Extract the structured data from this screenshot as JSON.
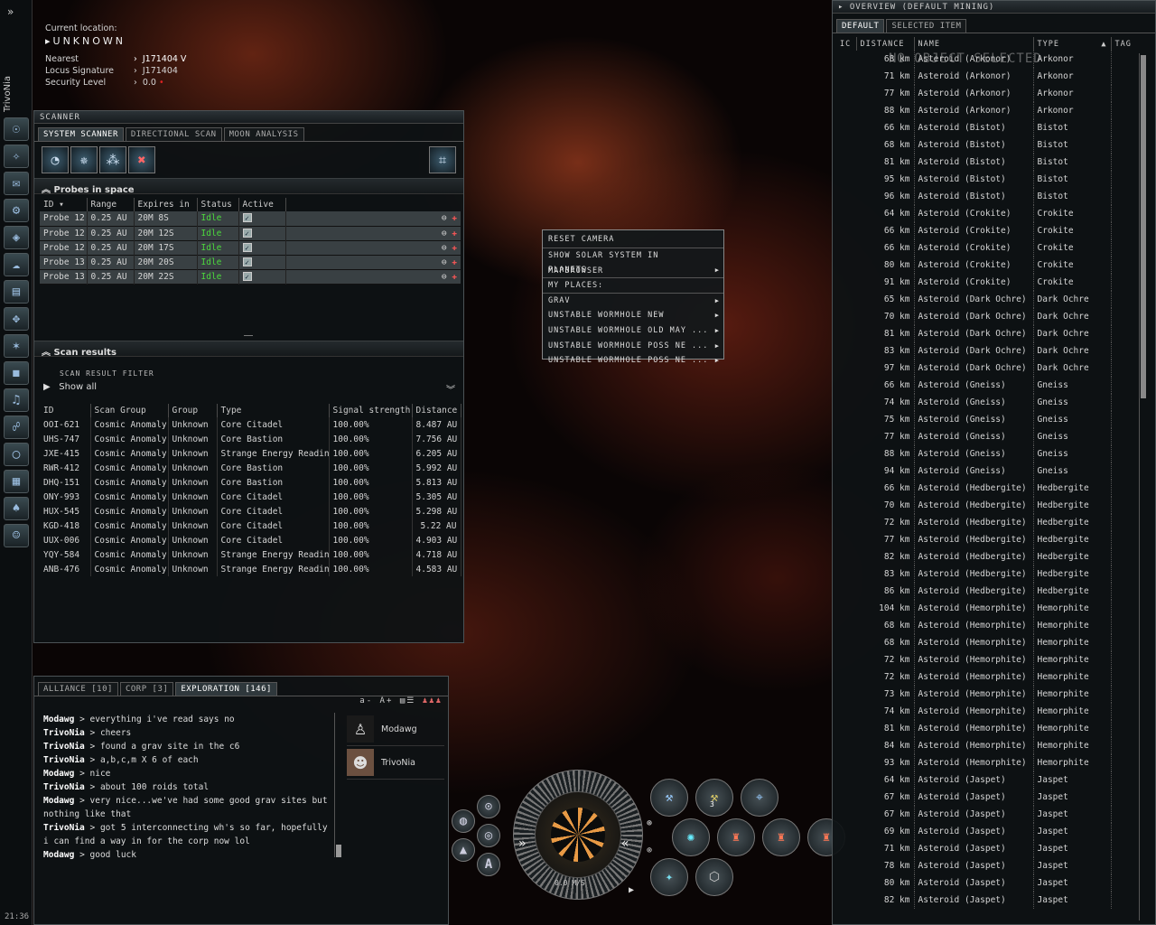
{
  "sidebar": {
    "player": "TrivoNia",
    "clock": "21:36"
  },
  "location": {
    "label": "Current location:",
    "name": "UNKNOWN",
    "nearest_label": "Nearest",
    "nearest": "J171404 V",
    "locus_label": "Locus Signature",
    "locus": "J171404",
    "security_label": "Security Level",
    "security": "0.0"
  },
  "scanner": {
    "title": "SCANNER",
    "tabs": [
      "SYSTEM SCANNER",
      "DIRECTIONAL SCAN",
      "MOON ANALYSIS"
    ],
    "probes_title": "Probes in space",
    "probe_columns": [
      "ID",
      "Range",
      "Expires in",
      "Status",
      "Active"
    ],
    "probes": [
      [
        "Probe 12",
        "0.25 AU",
        "20M 8S",
        "Idle"
      ],
      [
        "Probe 12",
        "0.25 AU",
        "20M 12S",
        "Idle"
      ],
      [
        "Probe 12",
        "0.25 AU",
        "20M 17S",
        "Idle"
      ],
      [
        "Probe 13",
        "0.25 AU",
        "20M 20S",
        "Idle"
      ],
      [
        "Probe 13",
        "0.25 AU",
        "20M 22S",
        "Idle"
      ]
    ],
    "results_title": "Scan results",
    "filter_label": "SCAN RESULT FILTER",
    "filter_value": "Show all",
    "result_columns": [
      "ID",
      "Scan Group",
      "Group",
      "Type",
      "Signal strength",
      "Distance"
    ],
    "results": [
      [
        "OOI-621",
        "Cosmic Anomaly",
        "Unknown",
        "Core Citadel",
        "100.00%",
        "8.487 AU"
      ],
      [
        "UHS-747",
        "Cosmic Anomaly",
        "Unknown",
        "Core Bastion",
        "100.00%",
        "7.756 AU"
      ],
      [
        "JXE-415",
        "Cosmic Anomaly",
        "Unknown",
        "Strange Energy Readings",
        "100.00%",
        "6.205 AU"
      ],
      [
        "RWR-412",
        "Cosmic Anomaly",
        "Unknown",
        "Core Bastion",
        "100.00%",
        "5.992 AU"
      ],
      [
        "DHQ-151",
        "Cosmic Anomaly",
        "Unknown",
        "Core Bastion",
        "100.00%",
        "5.813 AU"
      ],
      [
        "ONY-993",
        "Cosmic Anomaly",
        "Unknown",
        "Core Citadel",
        "100.00%",
        "5.305 AU"
      ],
      [
        "HUX-545",
        "Cosmic Anomaly",
        "Unknown",
        "Core Citadel",
        "100.00%",
        "5.298 AU"
      ],
      [
        "KGD-418",
        "Cosmic Anomaly",
        "Unknown",
        "Core Citadel",
        "100.00%",
        "5.22 AU"
      ],
      [
        "UUX-006",
        "Cosmic Anomaly",
        "Unknown",
        "Core Citadel",
        "100.00%",
        "4.903 AU"
      ],
      [
        "YQY-584",
        "Cosmic Anomaly",
        "Unknown",
        "Strange Energy Readings",
        "100.00%",
        "4.718 AU"
      ],
      [
        "ANB-476",
        "Cosmic Anomaly",
        "Unknown",
        "Strange Energy Readings",
        "100.00%",
        "4.583 AU"
      ]
    ]
  },
  "context_menu": {
    "items": [
      "RESET CAMERA",
      "SHOW SOLAR SYSTEM IN MAPBROWSER",
      "PLANETS",
      "MY PLACES:",
      "GRAV",
      "UNSTABLE WORMHOLE NEW",
      "UNSTABLE WORMHOLE OLD MAY ...",
      "UNSTABLE WORMHOLE POSS NE ...",
      "UNSTABLE WORMHOLE POSS NE ..."
    ]
  },
  "chat": {
    "tabs": [
      "ALLIANCE [10]",
      "CORP [3]",
      "EXPLORATION [146]"
    ],
    "messages": [
      [
        "Modawg",
        "> everything i've read says no"
      ],
      [
        "TrivoNia",
        "> cheers"
      ],
      [
        "TrivoNia",
        "> found a grav site in the c6"
      ],
      [
        "TrivoNia",
        "> a,b,c,m X 6 of each"
      ],
      [
        "Modawg",
        "> nice"
      ],
      [
        "TrivoNia",
        "> about 100 roids total"
      ],
      [
        "Modawg",
        "> very nice...we've had some good grav sites but nothing like that"
      ],
      [
        "TrivoNia",
        "> got 5 interconnecting wh's so far, hopefully i can find a way in for the corp now lol"
      ],
      [
        "Modawg",
        "> good luck"
      ]
    ],
    "members": [
      "Modawg",
      "TrivoNia"
    ]
  },
  "hud": {
    "speed": "0.0 M/S",
    "badge": "3"
  },
  "overview": {
    "title": "OVERVIEW (DEFAULT MINING)",
    "tabs": [
      "DEFAULT",
      "SELECTED ITEM"
    ],
    "no_selection": "NO OBJECT SELECTED",
    "columns": [
      "IC",
      "DISTANCE",
      "NAME",
      "TYPE",
      "TAG"
    ],
    "rows": [
      [
        "68 km",
        "Asteroid (Arkonor)",
        "Arkonor"
      ],
      [
        "71 km",
        "Asteroid (Arkonor)",
        "Arkonor"
      ],
      [
        "77 km",
        "Asteroid (Arkonor)",
        "Arkonor"
      ],
      [
        "88 km",
        "Asteroid (Arkonor)",
        "Arkonor"
      ],
      [
        "66 km",
        "Asteroid (Bistot)",
        "Bistot"
      ],
      [
        "68 km",
        "Asteroid (Bistot)",
        "Bistot"
      ],
      [
        "81 km",
        "Asteroid (Bistot)",
        "Bistot"
      ],
      [
        "95 km",
        "Asteroid (Bistot)",
        "Bistot"
      ],
      [
        "96 km",
        "Asteroid (Bistot)",
        "Bistot"
      ],
      [
        "64 km",
        "Asteroid (Crokite)",
        "Crokite"
      ],
      [
        "66 km",
        "Asteroid (Crokite)",
        "Crokite"
      ],
      [
        "66 km",
        "Asteroid (Crokite)",
        "Crokite"
      ],
      [
        "80 km",
        "Asteroid (Crokite)",
        "Crokite"
      ],
      [
        "91 km",
        "Asteroid (Crokite)",
        "Crokite"
      ],
      [
        "65 km",
        "Asteroid (Dark Ochre)",
        "Dark Ochre"
      ],
      [
        "70 km",
        "Asteroid (Dark Ochre)",
        "Dark Ochre"
      ],
      [
        "81 km",
        "Asteroid (Dark Ochre)",
        "Dark Ochre"
      ],
      [
        "83 km",
        "Asteroid (Dark Ochre)",
        "Dark Ochre"
      ],
      [
        "97 km",
        "Asteroid (Dark Ochre)",
        "Dark Ochre"
      ],
      [
        "66 km",
        "Asteroid (Gneiss)",
        "Gneiss"
      ],
      [
        "74 km",
        "Asteroid (Gneiss)",
        "Gneiss"
      ],
      [
        "75 km",
        "Asteroid (Gneiss)",
        "Gneiss"
      ],
      [
        "77 km",
        "Asteroid (Gneiss)",
        "Gneiss"
      ],
      [
        "88 km",
        "Asteroid (Gneiss)",
        "Gneiss"
      ],
      [
        "94 km",
        "Asteroid (Gneiss)",
        "Gneiss"
      ],
      [
        "66 km",
        "Asteroid (Hedbergite)",
        "Hedbergite"
      ],
      [
        "70 km",
        "Asteroid (Hedbergite)",
        "Hedbergite"
      ],
      [
        "72 km",
        "Asteroid (Hedbergite)",
        "Hedbergite"
      ],
      [
        "77 km",
        "Asteroid (Hedbergite)",
        "Hedbergite"
      ],
      [
        "82 km",
        "Asteroid (Hedbergite)",
        "Hedbergite"
      ],
      [
        "83 km",
        "Asteroid (Hedbergite)",
        "Hedbergite"
      ],
      [
        "86 km",
        "Asteroid (Hedbergite)",
        "Hedbergite"
      ],
      [
        "104 km",
        "Asteroid (Hemorphite)",
        "Hemorphite"
      ],
      [
        "68 km",
        "Asteroid (Hemorphite)",
        "Hemorphite"
      ],
      [
        "68 km",
        "Asteroid (Hemorphite)",
        "Hemorphite"
      ],
      [
        "72 km",
        "Asteroid (Hemorphite)",
        "Hemorphite"
      ],
      [
        "72 km",
        "Asteroid (Hemorphite)",
        "Hemorphite"
      ],
      [
        "73 km",
        "Asteroid (Hemorphite)",
        "Hemorphite"
      ],
      [
        "74 km",
        "Asteroid (Hemorphite)",
        "Hemorphite"
      ],
      [
        "81 km",
        "Asteroid (Hemorphite)",
        "Hemorphite"
      ],
      [
        "84 km",
        "Asteroid (Hemorphite)",
        "Hemorphite"
      ],
      [
        "93 km",
        "Asteroid (Hemorphite)",
        "Hemorphite"
      ],
      [
        "64 km",
        "Asteroid (Jaspet)",
        "Jaspet"
      ],
      [
        "67 km",
        "Asteroid (Jaspet)",
        "Jaspet"
      ],
      [
        "67 km",
        "Asteroid (Jaspet)",
        "Jaspet"
      ],
      [
        "69 km",
        "Asteroid (Jaspet)",
        "Jaspet"
      ],
      [
        "71 km",
        "Asteroid (Jaspet)",
        "Jaspet"
      ],
      [
        "78 km",
        "Asteroid (Jaspet)",
        "Jaspet"
      ],
      [
        "80 km",
        "Asteroid (Jaspet)",
        "Jaspet"
      ],
      [
        "82 km",
        "Asteroid (Jaspet)",
        "Jaspet"
      ]
    ]
  }
}
